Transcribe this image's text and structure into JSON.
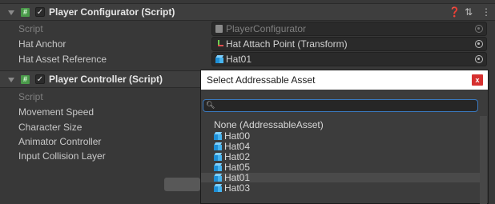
{
  "components": [
    {
      "title": "Player Configurator (Script)",
      "enabled_check": "✓",
      "header_icons": [
        "help-icon",
        "presets-icon",
        "more-icon"
      ],
      "fields": [
        {
          "label": "Script",
          "value": "PlayerConfigurator"
        },
        {
          "label": "Hat Anchor",
          "value": "Hat Attach Point (Transform)"
        },
        {
          "label": "Hat Asset Reference",
          "value": "Hat01"
        }
      ]
    },
    {
      "title": "Player Controller (Script)",
      "enabled_check": "✓",
      "fields": [
        {
          "label": "Script"
        },
        {
          "label": "Movement Speed"
        },
        {
          "label": "Character Size"
        },
        {
          "label": "Animator Controller"
        },
        {
          "label": "Input Collision Layer"
        }
      ]
    }
  ],
  "popup": {
    "title": "Select Addressable Asset",
    "close_label": "x",
    "search": {
      "value": ""
    },
    "items": [
      "None (AddressableAsset)",
      "Hat00",
      "Hat04",
      "Hat02",
      "Hat05",
      "Hat01",
      "Hat03"
    ],
    "selected_index": 5
  },
  "colors": {
    "accent": "#3a79bf",
    "close": "#d6302f",
    "script_icon": "#4a9a4a"
  }
}
